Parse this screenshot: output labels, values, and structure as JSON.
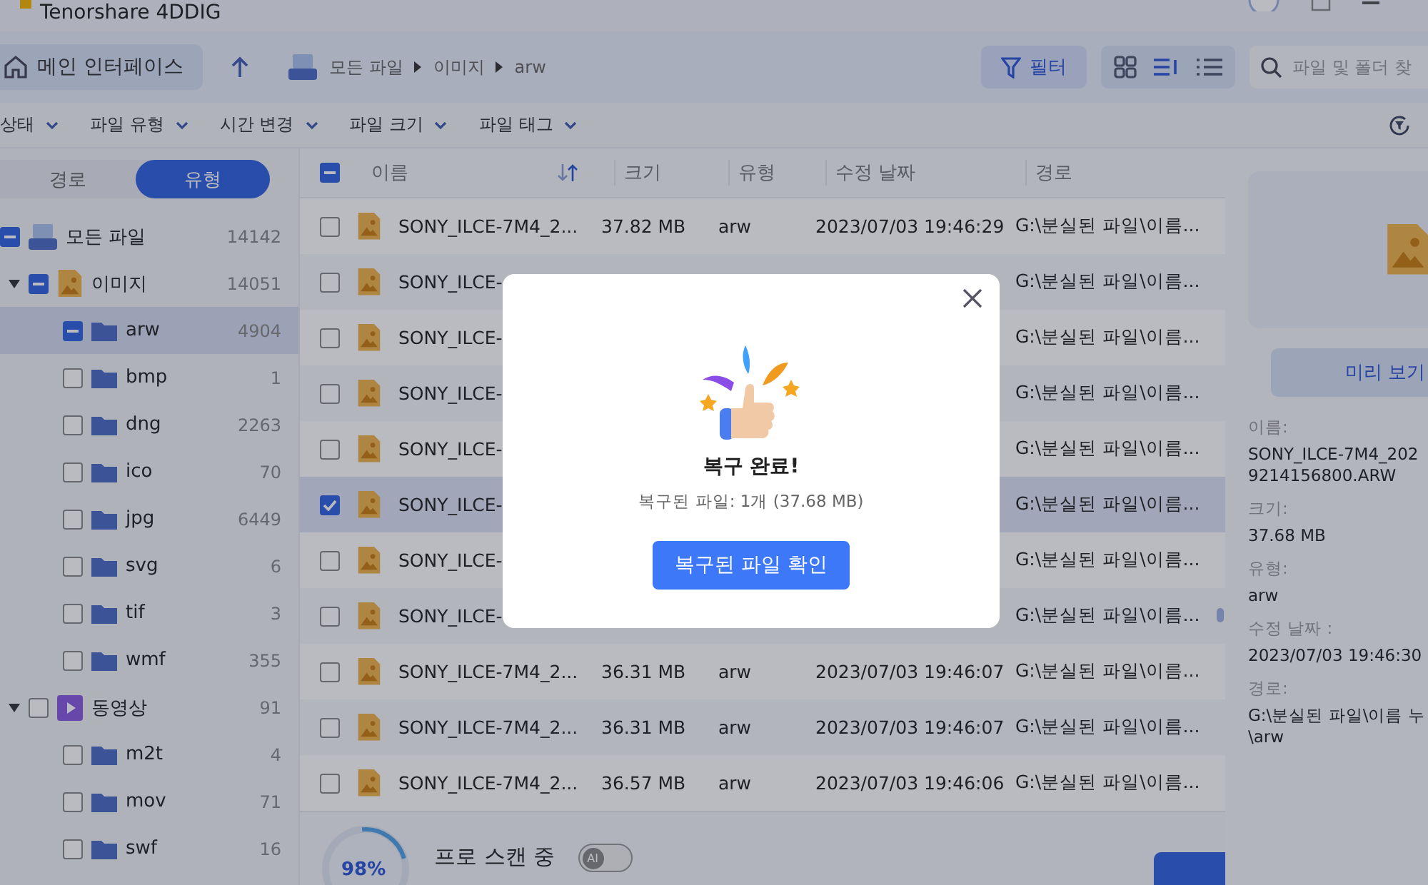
{
  "window": {
    "title": "Tenorshare 4DDIG"
  },
  "toolbar": {
    "home": "메인 인터페이스",
    "breadcrumb": [
      "모든 파일",
      "이미지",
      "arw"
    ],
    "filter": {
      "label": "필터",
      "selected": true
    },
    "views": [
      {
        "kind": "grid",
        "selected": false
      },
      {
        "kind": "detail",
        "selected": true
      },
      {
        "kind": "list",
        "selected": false
      }
    ],
    "search": {
      "placeholder": "파일 및 폴더 찾"
    }
  },
  "filters": [
    "상태",
    "파일 유형",
    "시간 변경",
    "파일 크기",
    "파일 태그"
  ],
  "sidebar": {
    "tabs": [
      {
        "label": "경로",
        "selected": false
      },
      {
        "label": "유형",
        "selected": true
      }
    ],
    "tree": [
      {
        "label": "모든 파일",
        "count": "14142",
        "kind": "drive",
        "mixed": true,
        "selected": false
      }
    ],
    "groups": [
      {
        "label": "이미지",
        "count": "14051",
        "kind": "image",
        "mixed": true,
        "expanded": true,
        "selected": false,
        "children": [
          {
            "label": "arw",
            "count": "4904",
            "kind": "folder",
            "mixed": true,
            "selected": true
          },
          {
            "label": "bmp",
            "count": "1",
            "kind": "folder",
            "checked": false,
            "mixed": false,
            "selected": false
          },
          {
            "label": "dng",
            "count": "2263",
            "kind": "folder",
            "checked": false,
            "mixed": false,
            "selected": false
          },
          {
            "label": "ico",
            "count": "70",
            "kind": "folder",
            "checked": false,
            "mixed": false,
            "selected": false
          },
          {
            "label": "jpg",
            "count": "6449",
            "kind": "folder",
            "checked": false,
            "mixed": false,
            "selected": false
          },
          {
            "label": "svg",
            "count": "6",
            "kind": "folder",
            "checked": false,
            "mixed": false,
            "selected": false
          },
          {
            "label": "tif",
            "count": "3",
            "kind": "folder",
            "checked": false,
            "mixed": false,
            "selected": false
          },
          {
            "label": "wmf",
            "count": "355",
            "kind": "folder",
            "checked": false,
            "mixed": false,
            "selected": false
          }
        ]
      },
      {
        "label": "동영상",
        "count": "91",
        "kind": "video",
        "checked": false,
        "mixed": false,
        "expanded": true,
        "selected": false,
        "children": [
          {
            "label": "m2t",
            "count": "4",
            "kind": "folder",
            "checked": false,
            "mixed": false,
            "selected": false
          },
          {
            "label": "mov",
            "count": "71",
            "kind": "folder",
            "checked": false,
            "mixed": false,
            "selected": false
          },
          {
            "label": "swf",
            "count": "16",
            "kind": "folder",
            "checked": false,
            "mixed": false,
            "selected": false
          }
        ]
      }
    ]
  },
  "table": {
    "header_check": {
      "mixed": true
    },
    "columns": [
      "이름",
      "크기",
      "유형",
      "수정 날짜",
      "경로"
    ],
    "rows": [
      {
        "name": "SONY_ILCE-7M4_2...",
        "size": "37.82 MB",
        "type": "arw",
        "modified": "2023/07/03 19:46:29",
        "path": "G:\\분실된 파일\\이름...",
        "checked": false,
        "selected": false
      },
      {
        "name": "SONY_ILCE-",
        "path": "G:\\분실된 파일\\이름...",
        "checked": false,
        "selected": false
      },
      {
        "name": "SONY_ILCE-",
        "path": "G:\\분실된 파일\\이름...",
        "checked": false,
        "selected": false
      },
      {
        "name": "SONY_ILCE-",
        "path": "G:\\분실된 파일\\이름...",
        "checked": false,
        "selected": false
      },
      {
        "name": "SONY_ILCE-",
        "path": "G:\\분실된 파일\\이름...",
        "checked": false,
        "selected": false
      },
      {
        "name": "SONY_ILCE-",
        "path": "G:\\분실된 파일\\이름...",
        "checked": true,
        "selected": true
      },
      {
        "name": "SONY_ILCE-",
        "path": "G:\\분실된 파일\\이름...",
        "checked": false,
        "selected": false
      },
      {
        "name": "SONY_ILCE-",
        "path": "G:\\분실된 파일\\이름...",
        "checked": false,
        "selected": false
      },
      {
        "name": "SONY_ILCE-7M4_2...",
        "size": "36.31 MB",
        "type": "arw",
        "modified": "2023/07/03 19:46:07",
        "path": "G:\\분실된 파일\\이름...",
        "checked": false,
        "selected": false
      },
      {
        "name": "SONY_ILCE-7M4_2...",
        "size": "36.31 MB",
        "type": "arw",
        "modified": "2023/07/03 19:46:07",
        "path": "G:\\분실된 파일\\이름...",
        "checked": false,
        "selected": false
      },
      {
        "name": "SONY_ILCE-7M4_2...",
        "size": "36.57 MB",
        "type": "arw",
        "modified": "2023/07/03 19:46:06",
        "path": "G:\\분실된 파일\\이름...",
        "checked": false,
        "selected": false
      }
    ]
  },
  "details": {
    "preview_button": "미리 보기",
    "fields": [
      {
        "label": "이름:",
        "lines": [
          "SONY_ILCE-7M4_202",
          "9214156800.ARW"
        ]
      },
      {
        "label": "크기:",
        "lines": [
          "37.68 MB"
        ]
      },
      {
        "label": "유형:",
        "lines": [
          "arw"
        ]
      },
      {
        "label": "수정 날짜 :",
        "lines": [
          "2023/07/03 19:46:30"
        ]
      },
      {
        "label": "경로:",
        "lines": [
          "G:\\분실된 파일\\이름 누",
          "\\arw"
        ]
      }
    ]
  },
  "footer": {
    "progress": "98%",
    "status": "프로 스캔 중",
    "ai_toggle": {
      "label": "AI",
      "on": false
    }
  },
  "dialog": {
    "title": "복구 완료!",
    "message": "복구된 파일: 1개 (37.68 MB)",
    "button": "복구된 파일 확인"
  }
}
